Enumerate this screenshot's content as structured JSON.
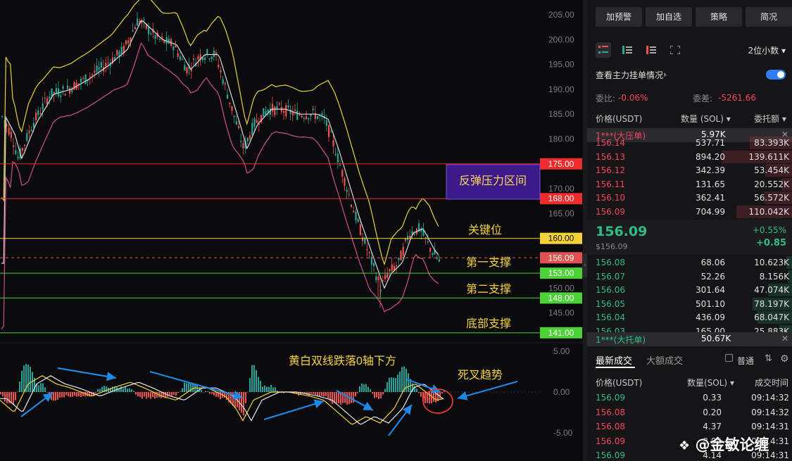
{
  "chart": {
    "price_axis": [
      "205.00",
      "200.00",
      "195.00",
      "190.00",
      "185.00",
      "180.00",
      "170.00",
      "165.00",
      "150.00",
      "145.00"
    ],
    "macd_axis": [
      "5.00",
      "0.00",
      "-5.00"
    ],
    "levels": [
      {
        "price": 175,
        "label": "175.00",
        "color": "#f02b2b",
        "text_color": "#ffffff"
      },
      {
        "price": 168,
        "label": "168.00",
        "color": "#f02b2b",
        "text_color": "#ffffff"
      },
      {
        "price": 160,
        "label": "160.00",
        "color": "#f4d33a",
        "text_color": "#111111"
      },
      {
        "price": 153,
        "label": "153.00",
        "color": "#4cd137",
        "text_color": "#ffffff"
      },
      {
        "price": 148,
        "label": "148.00",
        "color": "#4cd137",
        "text_color": "#ffffff"
      },
      {
        "price": 141,
        "label": "141.00",
        "color": "#4cd137",
        "text_color": "#ffffff"
      }
    ],
    "current_price": {
      "price": 156.09,
      "label": "156.09"
    },
    "annotations": {
      "resistance_zone": "反弹压力区间",
      "key_level": "关键位",
      "support1": "第一支撑",
      "support2": "第二支撑",
      "bottom_support": "底部支撑",
      "macd_note": "黄白双线跌落0轴下方",
      "death_cross": "死叉趋势"
    },
    "colors": {
      "up": "#26a69a",
      "down": "#ef5350",
      "boll_upper": "#e6d33c",
      "boll_mid": "#d8d8d8",
      "boll_lower": "#d0508a",
      "arrow": "#1e88e5"
    }
  },
  "panel": {
    "buttons": [
      "加预警",
      "加自选",
      "策略",
      "简况"
    ],
    "decimal": "2位小数",
    "toggle_label": "查看主力挂单情况",
    "weibi_label": "委比:",
    "weibi_value": "-0.06%",
    "weicha_label": "委差:",
    "weicha_value": "-5261.66",
    "ob_headers": {
      "price": "价格(USDT)",
      "qty": "数量 (SOL)",
      "amount": "委托额"
    },
    "sell_big": {
      "name": "1***(大压单)",
      "value": "5.97K"
    },
    "asks": [
      {
        "price": "156.14",
        "qty": "537.71",
        "amount": "83.393K"
      },
      {
        "price": "156.13",
        "qty": "894.20",
        "amount": "139.611K"
      },
      {
        "price": "156.12",
        "qty": "342.39",
        "amount": "53.454K"
      },
      {
        "price": "156.11",
        "qty": "131.65",
        "amount": "20.552K"
      },
      {
        "price": "156.10",
        "qty": "362.41",
        "amount": "56.572K"
      },
      {
        "price": "156.09",
        "qty": "704.99",
        "amount": "110.042K"
      }
    ],
    "last_price": "156.09",
    "last_price_sub": "$156.09",
    "change_pct": "+0.55%",
    "change_abs": "+0.85",
    "bids": [
      {
        "price": "156.08",
        "qty": "68.06",
        "amount": "10.623K"
      },
      {
        "price": "156.07",
        "qty": "52.26",
        "amount": "8.156K"
      },
      {
        "price": "156.06",
        "qty": "301.64",
        "amount": "47.074K"
      },
      {
        "price": "156.05",
        "qty": "501.10",
        "amount": "78.197K"
      },
      {
        "price": "156.04",
        "qty": "436.09",
        "amount": "68.047K"
      },
      {
        "price": "156.03",
        "qty": "165.00",
        "amount": "25.883K"
      }
    ],
    "buy_big": {
      "name": "1***(大托单)",
      "value": "50.67K"
    },
    "tab_latest": "最新成交",
    "tab_large": "大额成交",
    "normal_label": "普通",
    "trade_headers": {
      "price": "价格(USDT)",
      "qty": "数量(SOL)",
      "time": "成交时间"
    },
    "trades": [
      {
        "price": "156.09",
        "qty": "0.33",
        "time": "09:14:32",
        "side": "buy"
      },
      {
        "price": "156.08",
        "qty": "0.20",
        "time": "09:14:32",
        "side": "sell"
      },
      {
        "price": "156.08",
        "qty": "4.37",
        "time": "09:14:31",
        "side": "sell"
      },
      {
        "price": "156.09",
        "qty": "8.00",
        "time": "09:14:31",
        "side": "sell"
      },
      {
        "price": "156.09",
        "qty": "4.14",
        "time": "09:14:31",
        "side": "buy"
      }
    ]
  },
  "watermark": "@金敏论缠"
}
